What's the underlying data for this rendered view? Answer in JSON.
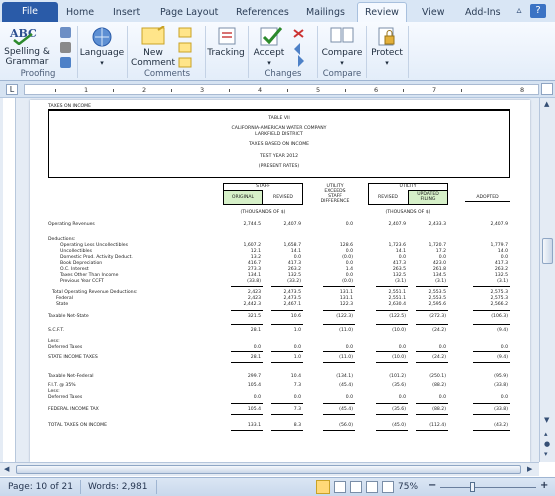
{
  "tabs": {
    "file": "File",
    "items": [
      "Home",
      "Insert",
      "Page Layout",
      "References",
      "Mailings",
      "Review",
      "View",
      "Add-Ins"
    ],
    "active": "Review"
  },
  "ribbon": {
    "spelling_label_1": "Spelling &",
    "spelling_label_2": "Grammar",
    "language_label": "Language",
    "new_comment_label_1": "New",
    "new_comment_label_2": "Comment",
    "tracking_label": "Tracking",
    "accept_label": "Accept",
    "compare_label": "Compare",
    "protect_label": "Protect",
    "groups": {
      "proofing": "Proofing",
      "comments": "Comments",
      "changes": "Changes",
      "compare": "Compare"
    }
  },
  "ruler": {
    "numbers": [
      "1",
      "2",
      "3",
      "4",
      "5",
      "6",
      "7",
      "8"
    ],
    "tab_selector": "L"
  },
  "document": {
    "header_left": "TAXES ON INCOME",
    "title": {
      "line1": "TABLE VII",
      "line2": "CALIFORNIA-AMERICAN WATER COMPANY",
      "line3": "LARKFIELD DISTRICT",
      "line4": "TAXES BASED ON INCOME",
      "line5": "TEST YEAR 2012",
      "line6": "(PRESENT RATES)"
    },
    "col_groups": {
      "staff": "STAFF",
      "utility_exceeds": "UTILITY\nEXCEEDS\nSTAFF\nDIFFERENCE",
      "utility": "UTILITY"
    },
    "cols": [
      "ORIGINAL",
      "REVISED",
      "",
      "REVISED",
      "UPDATED\nFILING",
      "ADOPTED"
    ],
    "thousands_1": "(THOUSANDS OF $)",
    "thousands_2": "(THOUSANDS OF $)",
    "rows": [
      {
        "label": "Operating Revenues",
        "vals": [
          "2,744.5",
          "2,407.9",
          "0.0",
          "2,407.9",
          "2,433.3",
          "2,407.9"
        ]
      },
      {
        "label": "Deductions:",
        "vals": [
          "",
          "",
          "",
          "",
          "",
          ""
        ]
      },
      {
        "label": "Operating Less Uncollectibles",
        "vals": [
          "1,607.2",
          "1,658.7",
          "128.6",
          "1,723.6",
          "1,720.7",
          "1,779.7"
        ]
      },
      {
        "label": "Uncollectibles",
        "vals": [
          "12.1",
          "14.1",
          "0.0",
          "14.1",
          "17.2",
          "14.0"
        ]
      },
      {
        "label": "Domestic Prod. Activity Deduct.",
        "vals": [
          "13.2",
          "0.0",
          "(0.0)",
          "0.0",
          "0.0",
          "0.0"
        ]
      },
      {
        "label": "Book Depreciation",
        "vals": [
          "416.7",
          "417.3",
          "0.0",
          "417.3",
          "423.0",
          "417.3"
        ]
      },
      {
        "label": "O.C. Interest",
        "vals": [
          "273.3",
          "263.2",
          "1.4",
          "263.5",
          "261.8",
          "263.2"
        ]
      },
      {
        "label": "Taxes Other Than Income",
        "vals": [
          "134.1",
          "132.5",
          "0.0",
          "132.5",
          "134.5",
          "132.5"
        ]
      },
      {
        "label": "Previous Year CCFT",
        "vals": [
          "(33.8)",
          "(33.2)",
          "(0.0)",
          "(3.1)",
          "(3.1)",
          "(3.1)"
        ]
      },
      {
        "label": "Total Operating Revenue Deductions:",
        "vals": [
          "2,423",
          "2,473.5",
          "131.1",
          "2,551.1",
          "2,553.5",
          "2,575.3"
        ]
      },
      {
        "label": "Federal",
        "vals": [
          "2,423",
          "2,473.5",
          "131.1",
          "2,551.1",
          "2,553.5",
          "2,575.3"
        ]
      },
      {
        "label": "State",
        "vals": [
          "2,442.3",
          "2,467.1",
          "122.3",
          "2,630.4",
          "2,595.6",
          "2,566.2"
        ]
      },
      {
        "label": "Taxable Net-State",
        "vals": [
          "321.5",
          "10.6",
          "(122.3)",
          "(122.5)",
          "(272.3)",
          "(106.3)"
        ]
      },
      {
        "label": "S.C.F.T.",
        "vals": [
          "28.1",
          "1.0",
          "(11.0)",
          "(10.0)",
          "(24.2)",
          "(9.4)"
        ]
      },
      {
        "label": "Less:",
        "vals": [
          "",
          "",
          "",
          "",
          "",
          ""
        ]
      },
      {
        "label": "Deferred Taxes",
        "vals": [
          "0.0",
          "0.0",
          "0.0",
          "0.0",
          "0.0",
          "0.0"
        ]
      },
      {
        "label": "STATE INCOME TAXES",
        "vals": [
          "28.1",
          "1.0",
          "(11.0)",
          "(10.0)",
          "(24.2)",
          "(9.4)"
        ]
      },
      {
        "label": "Taxable Net-Federal",
        "vals": [
          "299.7",
          "10.4",
          "(134.1)",
          "(101.2)",
          "(250.1)",
          "(95.9)"
        ]
      },
      {
        "label": "F.I.T. @ 35%",
        "vals": [
          "105.4",
          "7.3",
          "(45.4)",
          "(35.6)",
          "(88.2)",
          "(33.8)"
        ]
      },
      {
        "label": "Less:",
        "vals": [
          "",
          "",
          "",
          "",
          "",
          ""
        ]
      },
      {
        "label": "Deferred Taxes",
        "vals": [
          "0.0",
          "0.0",
          "0.0",
          "0.0",
          "0.0",
          "0.0"
        ]
      },
      {
        "label": "FEDERAL INCOME TAX",
        "vals": [
          "105.4",
          "7.3",
          "(45.4)",
          "(35.6)",
          "(88.2)",
          "(33.8)"
        ]
      },
      {
        "label": "TOTAL TAXES ON INCOME",
        "vals": [
          "133.1",
          "8.3",
          "(56.0)",
          "(45.0)",
          "(112.4)",
          "(43.2)"
        ]
      }
    ]
  },
  "status": {
    "page": "Page: 10 of 21",
    "words": "Words: 2,981",
    "zoom": "75%"
  }
}
